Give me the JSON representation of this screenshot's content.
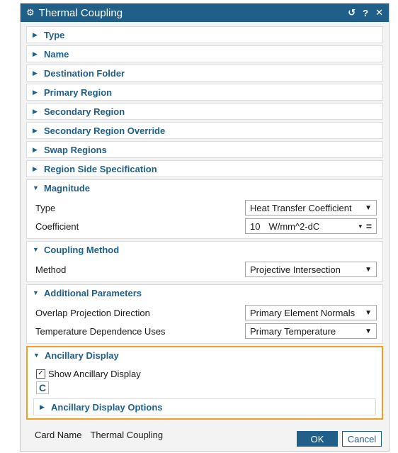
{
  "dialog": {
    "title": "Thermal Coupling",
    "title_icons": [
      "reset-icon",
      "help-icon",
      "close-icon"
    ],
    "reset_glyph": "↺",
    "help_glyph": "?",
    "close_glyph": "✕"
  },
  "collapsed_sections": [
    "Type",
    "Name",
    "Destination Folder",
    "Primary Region",
    "Secondary Region",
    "Secondary Region Override",
    "Swap Regions",
    "Region Side Specification"
  ],
  "magnitude": {
    "header": "Magnitude",
    "type_label": "Type",
    "type_value": "Heat Transfer Coefficient",
    "coefficient_label": "Coefficient",
    "coefficient_value": "10",
    "coefficient_unit": "W/mm^2-dC"
  },
  "coupling_method": {
    "header": "Coupling Method",
    "method_label": "Method",
    "method_value": "Projective Intersection"
  },
  "additional_parameters": {
    "header": "Additional Parameters",
    "overlap_label": "Overlap Projection Direction",
    "overlap_value": "Primary Element Normals",
    "temperature_label": "Temperature Dependence Uses",
    "temperature_value": "Primary Temperature"
  },
  "ancillary_display": {
    "header": "Ancillary Display",
    "show_label": "Show Ancillary Display",
    "show_checked": true,
    "options_header": "Ancillary Display Options",
    "highlight_color": "#f0a020"
  },
  "card": {
    "label": "Card Name",
    "value": "Thermal Coupling"
  },
  "buttons": {
    "ok": "OK",
    "cancel": "Cancel"
  },
  "colors": {
    "title_bar": "#1f5f8a",
    "accent": "#1f5f8a"
  }
}
